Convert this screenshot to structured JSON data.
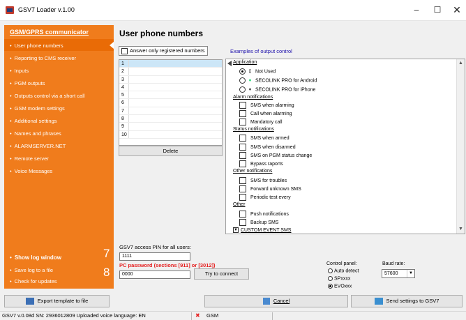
{
  "window": {
    "title": "GSV7 Loader v.1.00",
    "controls": {
      "minimize": "–",
      "maximize": "☐",
      "close": "✕"
    }
  },
  "sidebar": {
    "title": "GSM/GPRS communicator",
    "items": [
      "User phone numbers",
      "Reporting to CMS receiver",
      "Inputs",
      "PGM outputs",
      "Outputs control via a short call",
      "GSM modem settings",
      "Additional settings",
      "Names and phrases",
      "ALARMSERVER.NET",
      "Remote server",
      "Voice Messages"
    ],
    "bottom": {
      "show_log": "Show log window",
      "save_log": "Save log to a file",
      "check_updates": "Check for updates",
      "badge7": "7",
      "badge8": "8"
    }
  },
  "main": {
    "title": "User phone numbers",
    "answer_only": "Answer only registered numbers",
    "examples_link": "Examples of output control",
    "phone_rows": [
      "1",
      "2",
      "3",
      "4",
      "5",
      "6",
      "7",
      "8",
      "9",
      "10"
    ],
    "delete_label": "Delete"
  },
  "tree": {
    "application": {
      "label": "Application",
      "options": [
        "Not Used",
        "SECOLINK PRO for Android",
        "SECOLINK PRO for iPhone"
      ],
      "selected": 0
    },
    "alarm": {
      "label": "Alarm notifications",
      "options": [
        "SMS when alarming",
        "Call when alarming",
        "Mandatory call"
      ]
    },
    "status": {
      "label": "Status notifications",
      "options": [
        "SMS when armed",
        "SMS when disarmed",
        "SMS on PGM status change",
        "Bypass raports"
      ]
    },
    "other_notif": {
      "label": "Other notifications",
      "options": [
        "SMS for troubles",
        "Forward unknown SMS",
        "Periodic test every"
      ]
    },
    "other": {
      "label": "Other",
      "options": [
        "Push notifications",
        "Backup SMS"
      ]
    },
    "custom": "CUSTOM EVENT SMS"
  },
  "config": {
    "pin_label": "GSV7 access PIN for all users:",
    "pin_value": "1111",
    "pc_label": "PC password (sections [911] or [3012])",
    "pc_value": "0000",
    "connect_label": "Try to connect",
    "control_panel_label": "Control panel:",
    "control_panel_options": [
      "Auto detect",
      "SPxxxx",
      "EVOxxx"
    ],
    "control_panel_selected": 2,
    "baud_label": "Baud rate:",
    "baud_value": "57600"
  },
  "actions": {
    "export": "Export template to file",
    "cancel": "Cancel",
    "send": "Send settings to GSV7"
  },
  "status": {
    "text": "GSV7 v.0.08d   SN: 2936012809   Uploaded voice language: EN",
    "gsm": "GSM"
  },
  "colors": {
    "sidebar": "#f07c1c",
    "sidebar_selected": "#e96b06",
    "link": "#1a0dab",
    "warning": "#e52020"
  }
}
